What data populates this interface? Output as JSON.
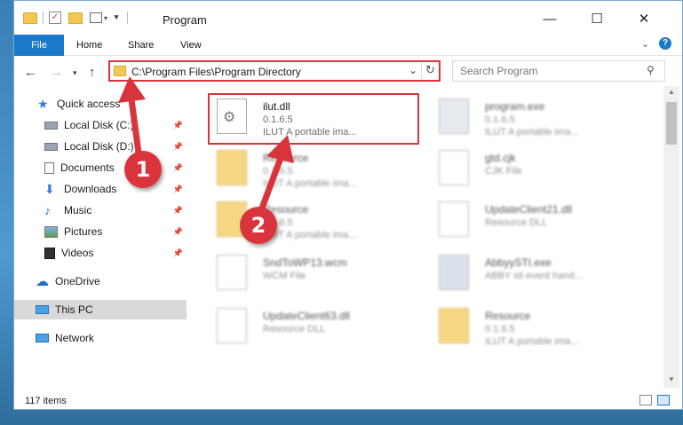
{
  "window": {
    "title": "Program",
    "controls": {
      "minimize": "—",
      "maximize": "☐",
      "close": "✕"
    }
  },
  "ribbon": {
    "tabs": [
      {
        "label": "File"
      },
      {
        "label": "Home"
      },
      {
        "label": "Share"
      },
      {
        "label": "View"
      }
    ]
  },
  "address": {
    "path": "C:\\Program Files\\Program Directory"
  },
  "search": {
    "placeholder": "Search Program"
  },
  "sidebar": {
    "items": [
      {
        "label": "Quick access",
        "icon": "star-icon"
      },
      {
        "label": "Local Disk (C:)",
        "icon": "drive-icon",
        "pinned": true
      },
      {
        "label": "Local Disk (D:)",
        "icon": "drive-icon",
        "pinned": true
      },
      {
        "label": "Documents",
        "icon": "documents-icon",
        "pinned": true
      },
      {
        "label": "Downloads",
        "icon": "download-icon",
        "pinned": true
      },
      {
        "label": "Music",
        "icon": "music-icon",
        "pinned": true
      },
      {
        "label": "Pictures",
        "icon": "pictures-icon",
        "pinned": true
      },
      {
        "label": "Videos",
        "icon": "videos-icon",
        "pinned": true
      },
      {
        "label": "OneDrive",
        "icon": "cloud-icon"
      },
      {
        "label": "This PC",
        "icon": "computer-icon",
        "selected": true
      },
      {
        "label": "Network",
        "icon": "network-icon"
      }
    ]
  },
  "files": [
    {
      "name": "ilut.dll",
      "line2": "0.1.6.5",
      "line3": "ILUT A portable ima...",
      "icon": "dll-icon"
    },
    {
      "name": "program.exe",
      "line2": "0.1.6.5",
      "line3": "ILUT A portable ima...",
      "icon": "exe-icon"
    },
    {
      "name": "Resource",
      "line2": "0.1.6.5",
      "line3": "ILUT A portable ima...",
      "icon": "folder-icon"
    },
    {
      "name": "gtd.cjk",
      "line2": "CJK File",
      "line3": "",
      "icon": "file-icon"
    },
    {
      "name": "Resource",
      "line2": "0.1.6.5",
      "line3": "ILUT A portable ima...",
      "icon": "folder-icon"
    },
    {
      "name": "UpdateClient21.dll",
      "line2": "Resource DLL",
      "line3": "",
      "icon": "dll-icon"
    },
    {
      "name": "SndToWP13.wcm",
      "line2": "WCM File",
      "line3": "",
      "icon": "file-icon"
    },
    {
      "name": "AbbyySTI.exe",
      "line2": "ABBY sti event hand...",
      "line3": "",
      "icon": "exe-icon"
    },
    {
      "name": "UpdateClient63.dll",
      "line2": "Resource DLL",
      "line3": "",
      "icon": "dll-icon"
    },
    {
      "name": "Resource",
      "line2": "0.1.6.5",
      "line3": "ILUT A portable ima...",
      "icon": "folder-icon"
    }
  ],
  "status": {
    "count": "117 items"
  },
  "annotations": {
    "step1": "1",
    "step2": "2",
    "accent": "#d9343b"
  }
}
